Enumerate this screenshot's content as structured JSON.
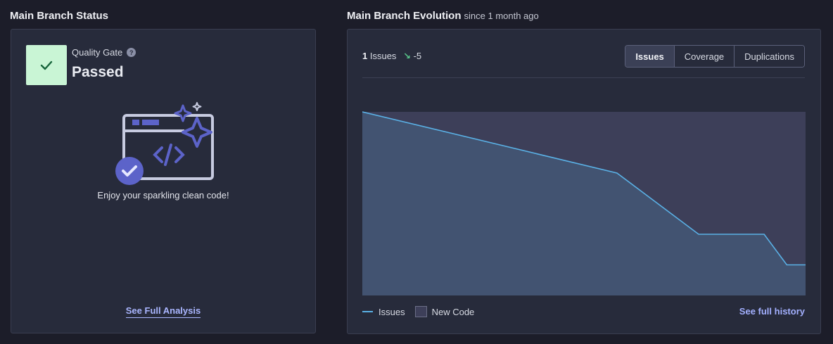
{
  "status_section": {
    "title": "Main Branch Status",
    "quality_gate_label": "Quality Gate",
    "quality_gate_value": "Passed",
    "message": "Enjoy your sparkling clean code!",
    "link": "See Full Analysis"
  },
  "evolution_section": {
    "title": "Main Branch Evolution",
    "subtitle": "since 1 month ago",
    "metric_value": "1",
    "metric_label": "Issues",
    "delta": "-5",
    "tabs": [
      "Issues",
      "Coverage",
      "Duplications"
    ],
    "active_tab": "Issues",
    "legend_issues": "Issues",
    "legend_new_code": "New Code",
    "history_link": "See full history"
  },
  "chart_data": {
    "type": "area",
    "x": [
      0,
      1,
      2,
      3,
      4,
      5
    ],
    "values": [
      6,
      4,
      2,
      2,
      1,
      1
    ],
    "ylim": [
      0,
      6
    ],
    "series_color": "#5ab1e6",
    "new_code_color": "#3d3f59",
    "grid": false
  },
  "colors": {
    "background": "#1c1d29",
    "card": "#272b3b",
    "passed": "#c9f5d5",
    "link": "#aab6ff"
  }
}
